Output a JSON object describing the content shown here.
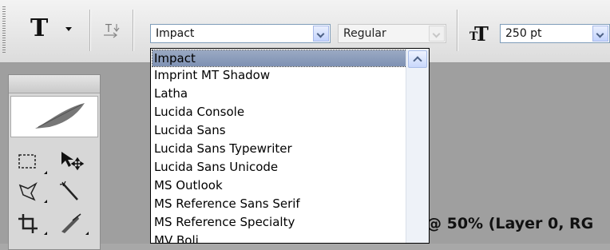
{
  "options_bar": {
    "tool_icon": "T",
    "font_family": {
      "value": "Impact"
    },
    "font_style": {
      "value": "Regular"
    },
    "font_size": {
      "value": "250 pt"
    }
  },
  "font_list": {
    "items": [
      "Impact",
      "Imprint MT Shadow",
      "Latha",
      "Lucida Console",
      "Lucida Sans",
      "Lucida Sans Typewriter",
      "Lucida Sans Unicode",
      "MS Outlook",
      "MS Reference Sans Serif",
      "MS Reference Specialty",
      "MV Boli"
    ],
    "selected_index": 0
  },
  "document": {
    "title_fragment": "@ 50% (Layer 0, RG"
  },
  "colors": {
    "selection": "#8c9cbc",
    "workspace": "#9f9f9f"
  }
}
